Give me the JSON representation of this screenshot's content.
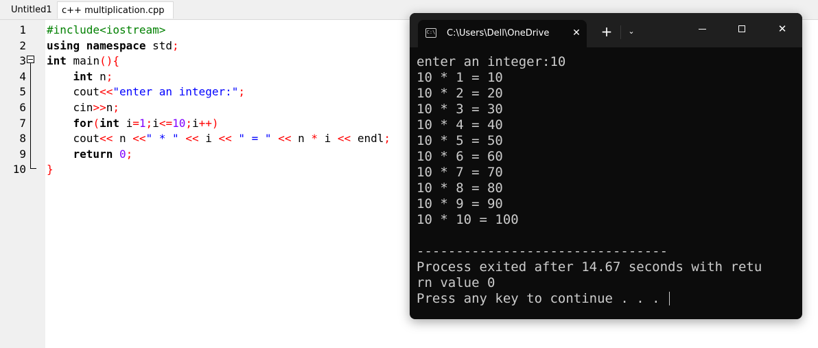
{
  "editor": {
    "tabs": [
      {
        "label": "Untitled1"
      },
      {
        "label": "c++ multiplication.cpp"
      }
    ],
    "line_numbers": [
      "1",
      "2",
      "3",
      "4",
      "5",
      "6",
      "7",
      "8",
      "9",
      "10"
    ],
    "lines": [
      [
        {
          "t": "#include<iostream>",
          "k": "pp"
        }
      ],
      [
        {
          "t": "using namespace",
          "k": "kw"
        },
        {
          "t": " std",
          "k": "id"
        },
        {
          "t": ";",
          "k": "op"
        }
      ],
      [
        {
          "t": "int",
          "k": "kw"
        },
        {
          "t": " main",
          "k": "id"
        },
        {
          "t": "(){",
          "k": "op"
        }
      ],
      [
        {
          "t": "    int",
          "k": "kw"
        },
        {
          "t": " n",
          "k": "id"
        },
        {
          "t": ";",
          "k": "op"
        }
      ],
      [
        {
          "t": "    cout",
          "k": "id"
        },
        {
          "t": "<<",
          "k": "op"
        },
        {
          "t": "\"enter an integer:\"",
          "k": "str"
        },
        {
          "t": ";",
          "k": "op"
        }
      ],
      [
        {
          "t": "    cin",
          "k": "id"
        },
        {
          "t": ">>",
          "k": "op"
        },
        {
          "t": "n",
          "k": "id"
        },
        {
          "t": ";",
          "k": "op"
        }
      ],
      [
        {
          "t": "    for",
          "k": "kw"
        },
        {
          "t": "(",
          "k": "op"
        },
        {
          "t": "int",
          "k": "kw"
        },
        {
          "t": " i",
          "k": "id"
        },
        {
          "t": "=",
          "k": "op"
        },
        {
          "t": "1",
          "k": "num"
        },
        {
          "t": ";",
          "k": "op"
        },
        {
          "t": "i",
          "k": "id"
        },
        {
          "t": "<=",
          "k": "op"
        },
        {
          "t": "10",
          "k": "num"
        },
        {
          "t": ";",
          "k": "op"
        },
        {
          "t": "i",
          "k": "id"
        },
        {
          "t": "++)",
          "k": "op"
        }
      ],
      [
        {
          "t": "    cout",
          "k": "id"
        },
        {
          "t": "<<",
          "k": "op"
        },
        {
          "t": " n ",
          "k": "id"
        },
        {
          "t": "<<",
          "k": "op"
        },
        {
          "t": "\" * \"",
          "k": "str"
        },
        {
          "t": " ",
          "k": "id"
        },
        {
          "t": "<<",
          "k": "op"
        },
        {
          "t": " i ",
          "k": "id"
        },
        {
          "t": "<<",
          "k": "op"
        },
        {
          "t": " ",
          "k": "id"
        },
        {
          "t": "\" = \"",
          "k": "str"
        },
        {
          "t": " ",
          "k": "id"
        },
        {
          "t": "<<",
          "k": "op"
        },
        {
          "t": " n ",
          "k": "id"
        },
        {
          "t": "*",
          "k": "op"
        },
        {
          "t": " i ",
          "k": "id"
        },
        {
          "t": "<<",
          "k": "op"
        },
        {
          "t": " endl",
          "k": "id"
        },
        {
          "t": ";",
          "k": "op"
        }
      ],
      [
        {
          "t": "    return",
          "k": "kw"
        },
        {
          "t": " ",
          "k": "id"
        },
        {
          "t": "0",
          "k": "num"
        },
        {
          "t": ";",
          "k": "op"
        }
      ],
      [
        {
          "t": "}",
          "k": "op"
        }
      ]
    ],
    "current_line": 1
  },
  "terminal": {
    "tab_title": "C:\\Users\\Dell\\OneDrive",
    "tab_icon": "console-icon",
    "close_glyph": "✕",
    "new_tab_glyph": "+",
    "dropdown_glyph": "⌄",
    "window_close_glyph": "✕",
    "output": [
      "enter an integer:10",
      "10 * 1 = 10",
      "10 * 2 = 20",
      "10 * 3 = 30",
      "10 * 4 = 40",
      "10 * 5 = 50",
      "10 * 6 = 60",
      "10 * 7 = 70",
      "10 * 8 = 80",
      "10 * 9 = 90",
      "10 * 10 = 100",
      "",
      "--------------------------------",
      "Process exited after 14.67 seconds with retu",
      "rn value 0",
      "Press any key to continue . . . "
    ]
  },
  "colors": {
    "preprocessor": "#008000",
    "keyword": "#000000",
    "operator": "#ff0000",
    "string": "#0000ff",
    "number": "#8000ff",
    "current_line_bg": "#c9fbfb",
    "terminal_bg": "#0c0c0c",
    "terminal_text": "#cccccc"
  }
}
